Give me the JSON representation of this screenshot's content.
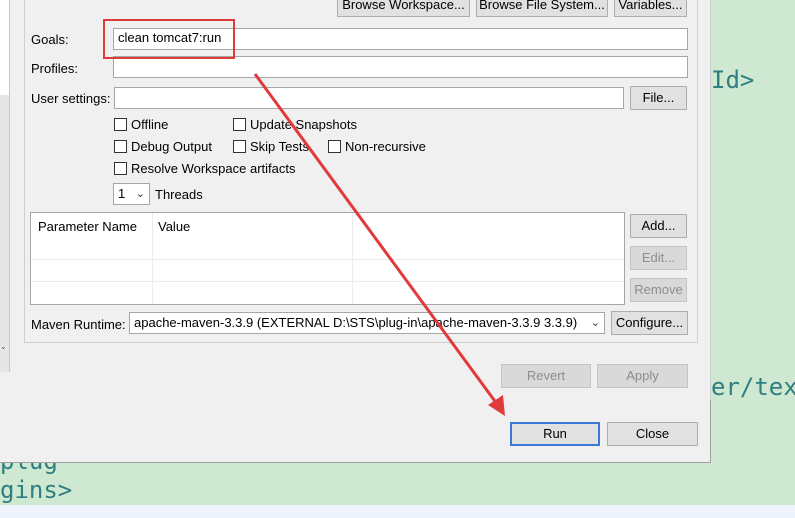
{
  "background_code": {
    "line1": "Id>",
    "line2": "er/tex",
    "line3": "plug",
    "line4": "gins>"
  },
  "top_buttons": {
    "browse_workspace": "Browse Workspace...",
    "browse_file_system": "Browse File System...",
    "variables": "Variables..."
  },
  "form": {
    "goals_label": "Goals:",
    "goals_value": "clean tomcat7:run",
    "profiles_label": "Profiles:",
    "profiles_value": "",
    "user_settings_label": "User settings:",
    "user_settings_value": "",
    "file_button": "File..."
  },
  "options": {
    "offline": "Offline",
    "update_snapshots": "Update Snapshots",
    "debug_output": "Debug Output",
    "skip_tests": "Skip Tests",
    "non_recursive": "Non-recursive",
    "resolve_workspace": "Resolve Workspace artifacts",
    "threads_value": "1",
    "threads_label": "Threads"
  },
  "parameters": {
    "columns": [
      "Parameter Name",
      "Value"
    ],
    "add_button": "Add...",
    "edit_button": "Edit...",
    "remove_button": "Remove"
  },
  "runtime": {
    "label": "Maven Runtime:",
    "value": "apache-maven-3.3.9 (EXTERNAL D:\\STS\\plug-in\\apache-maven-3.3.9 3.3.9)",
    "configure_button": "Configure..."
  },
  "actions": {
    "revert": "Revert",
    "apply": "Apply",
    "run": "Run",
    "close": "Close"
  },
  "colors": {
    "annotation_red": "#e03b3b",
    "background_green": "#cfe8d2",
    "code_teal": "#2f7f80"
  }
}
